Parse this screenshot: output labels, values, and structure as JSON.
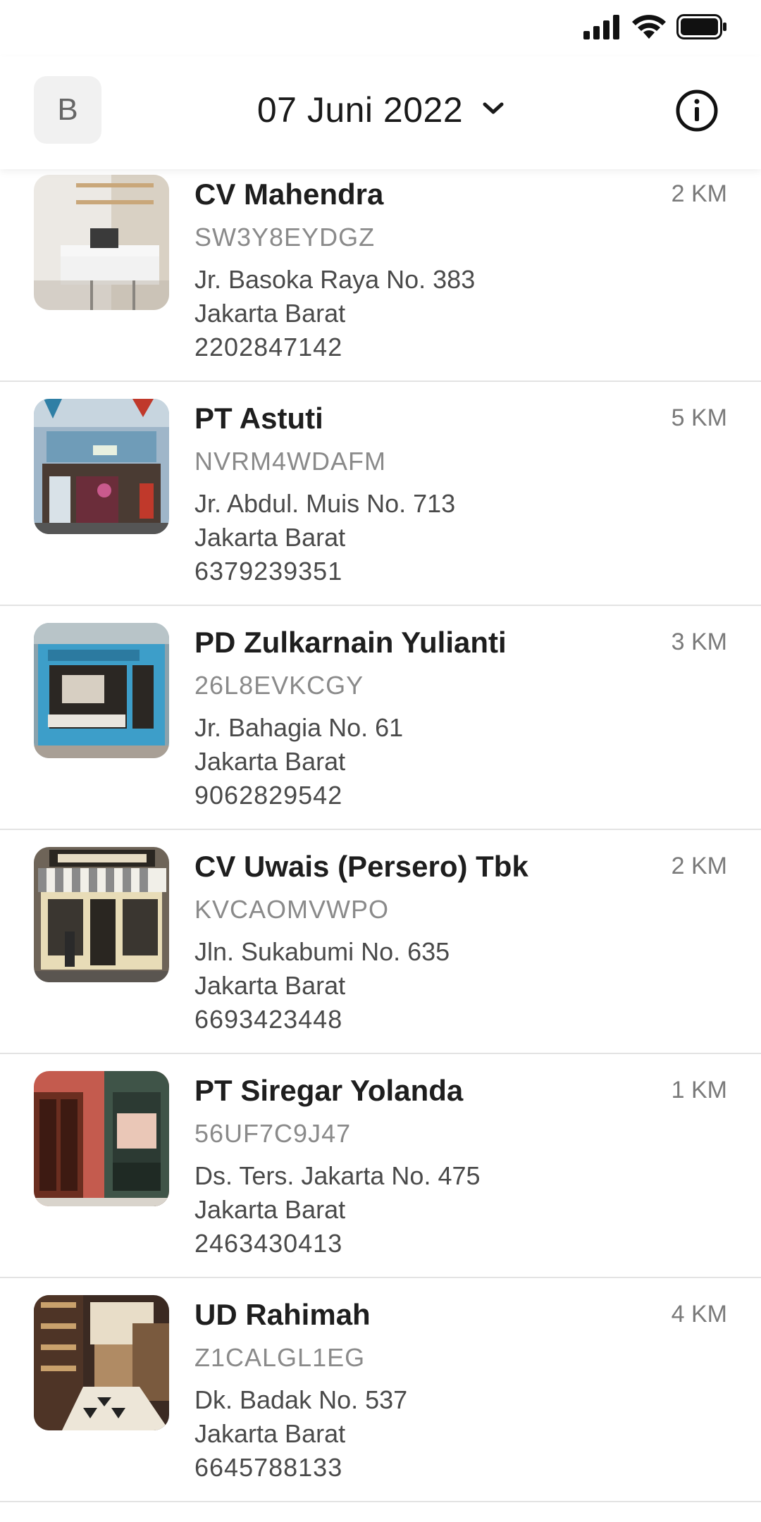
{
  "header": {
    "avatar_initial": "B",
    "date": "07 Juni 2022"
  },
  "stores": [
    {
      "name": "CV Mahendra",
      "code": "SW3Y8EYDGZ",
      "address": "Jr. Basoka Raya No. 383",
      "city": "Jakarta Barat",
      "phone": "2202847142",
      "distance": "2 KM"
    },
    {
      "name": "PT Astuti",
      "code": "NVRM4WDAFM",
      "address": "Jr. Abdul. Muis No. 713",
      "city": "Jakarta Barat",
      "phone": "6379239351",
      "distance": "5 KM"
    },
    {
      "name": "PD Zulkarnain Yulianti",
      "code": "26L8EVKCGY",
      "address": "Jr. Bahagia No. 61",
      "city": "Jakarta Barat",
      "phone": "9062829542",
      "distance": "3 KM"
    },
    {
      "name": "CV Uwais (Persero) Tbk",
      "code": "KVCAOMVWPO",
      "address": "Jln. Sukabumi No. 635",
      "city": "Jakarta Barat",
      "phone": "6693423448",
      "distance": "2 KM"
    },
    {
      "name": "PT Siregar Yolanda",
      "code": "56UF7C9J47",
      "address": "Ds. Ters. Jakarta No. 475",
      "city": "Jakarta Barat",
      "phone": "2463430413",
      "distance": "1 KM"
    },
    {
      "name": "UD Rahimah",
      "code": "Z1CALGL1EG",
      "address": "Dk. Badak No. 537",
      "city": "Jakarta Barat",
      "phone": "6645788133",
      "distance": "4 KM"
    }
  ],
  "icons": {
    "signal": "signal-icon",
    "wifi": "wifi-icon",
    "battery": "battery-icon",
    "chevron": "chevron-down-icon",
    "info": "info-icon"
  }
}
